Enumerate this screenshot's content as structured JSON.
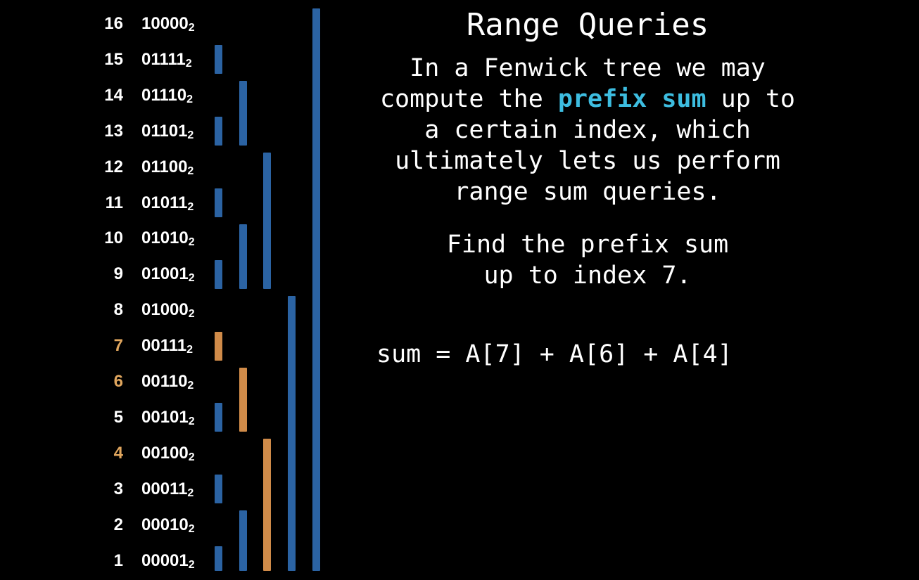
{
  "title": "Range Queries",
  "paragraph": {
    "line1": "In a Fenwick tree we may",
    "line2_before": "compute the ",
    "line2_highlight": "prefix sum",
    "line2_after": " up to",
    "line3": "a certain index, which",
    "line4": "ultimately lets us perform",
    "line5": "range sum queries."
  },
  "question": {
    "line1": "Find the prefix sum",
    "line2": "up to index 7."
  },
  "sum_expression": "sum = A[7] + A[6] + A[4]",
  "colors": {
    "background": "#000000",
    "text": "#ffffff",
    "bar_blue": "#2b63a3",
    "bar_orange": "#d08b49",
    "index_highlight": "#e0a65e",
    "keyword_highlight": "#3dbde0"
  },
  "subscript_base": "2",
  "rows": [
    {
      "index": "16",
      "binary": "10000",
      "highlighted": false,
      "responsibility": 16
    },
    {
      "index": "15",
      "binary": "01111",
      "highlighted": false,
      "responsibility": 1
    },
    {
      "index": "14",
      "binary": "01110",
      "highlighted": false,
      "responsibility": 2
    },
    {
      "index": "13",
      "binary": "01101",
      "highlighted": false,
      "responsibility": 1
    },
    {
      "index": "12",
      "binary": "01100",
      "highlighted": false,
      "responsibility": 4
    },
    {
      "index": "11",
      "binary": "01011",
      "highlighted": false,
      "responsibility": 1
    },
    {
      "index": "10",
      "binary": "01010",
      "highlighted": false,
      "responsibility": 2
    },
    {
      "index": "9",
      "binary": "01001",
      "highlighted": false,
      "responsibility": 1
    },
    {
      "index": "8",
      "binary": "01000",
      "highlighted": false,
      "responsibility": 8
    },
    {
      "index": "7",
      "binary": "00111",
      "highlighted": true,
      "responsibility": 1
    },
    {
      "index": "6",
      "binary": "00110",
      "highlighted": true,
      "responsibility": 2
    },
    {
      "index": "5",
      "binary": "00101",
      "highlighted": false,
      "responsibility": 1
    },
    {
      "index": "4",
      "binary": "00100",
      "highlighted": true,
      "responsibility": 4
    },
    {
      "index": "3",
      "binary": "00011",
      "highlighted": false,
      "responsibility": 1
    },
    {
      "index": "2",
      "binary": "00010",
      "highlighted": false,
      "responsibility": 2
    },
    {
      "index": "1",
      "binary": "00001",
      "highlighted": false,
      "responsibility": 1
    }
  ]
}
